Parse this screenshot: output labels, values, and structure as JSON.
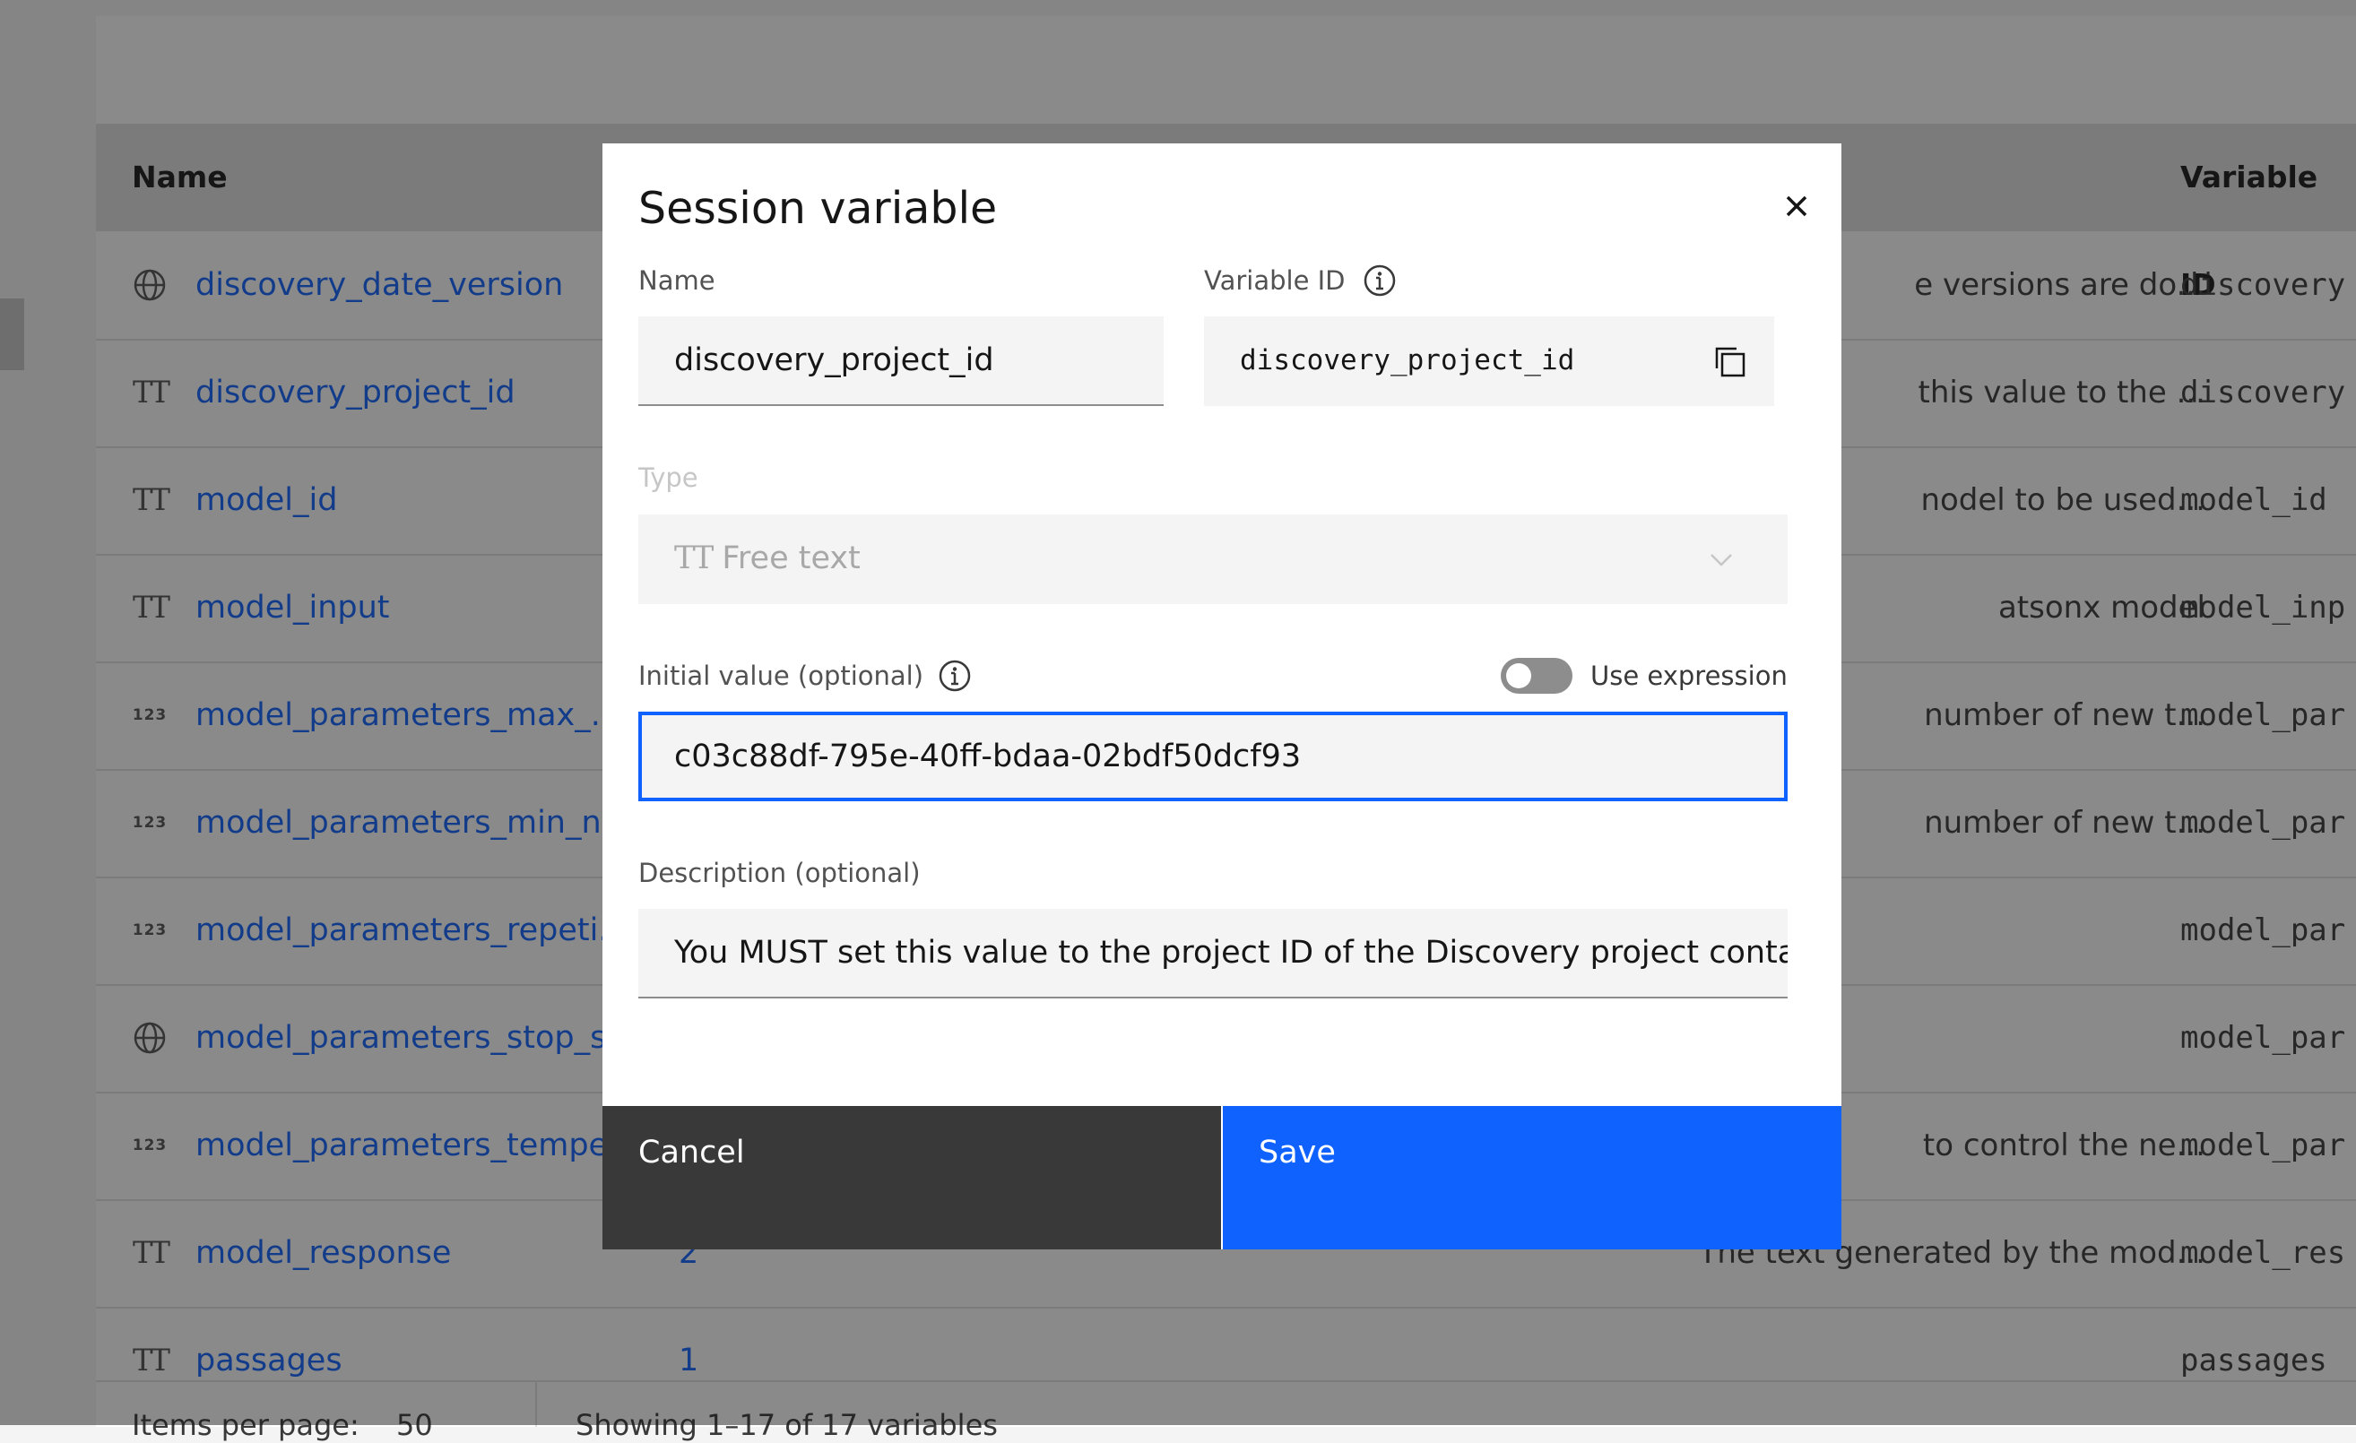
{
  "table": {
    "headers": {
      "name": "Name",
      "variable_id": "Variable ID"
    },
    "rows": [
      {
        "icon": "globe-icon",
        "name": "discovery_date_version",
        "count": "",
        "description": "e versions are do...",
        "variable_id": "discovery"
      },
      {
        "icon": "text-type-icon",
        "name": "discovery_project_id",
        "count": "",
        "description": "this value to the ...",
        "variable_id": "discovery"
      },
      {
        "icon": "text-type-icon",
        "name": "model_id",
        "count": "",
        "description": "nodel to be used...",
        "variable_id": "model_id"
      },
      {
        "icon": "text-type-icon",
        "name": "model_input",
        "count": "",
        "description": "atsonx model",
        "variable_id": "model_inp"
      },
      {
        "icon": "number-type-icon",
        "name": "model_parameters_max_...",
        "count": "",
        "description": "number of new t...",
        "variable_id": "model_par"
      },
      {
        "icon": "number-type-icon",
        "name": "model_parameters_min_n...",
        "count": "",
        "description": "number of new t...",
        "variable_id": "model_par"
      },
      {
        "icon": "number-type-icon",
        "name": "model_parameters_repeti...",
        "count": "",
        "description": "",
        "variable_id": "model_par"
      },
      {
        "icon": "globe-icon",
        "name": "model_parameters_stop_s...",
        "count": "",
        "description": "",
        "variable_id": "model_par"
      },
      {
        "icon": "number-type-icon",
        "name": "model_parameters_tempe...",
        "count": "",
        "description": "to control the ne...",
        "variable_id": "model_par"
      },
      {
        "icon": "text-type-icon",
        "name": "model_response",
        "count": "2",
        "description": "The text generated by the mod...",
        "variable_id": "model_res"
      },
      {
        "icon": "text-type-icon",
        "name": "passages",
        "count": "1",
        "description": "",
        "variable_id": "passages"
      }
    ],
    "footer": {
      "items_per_page_label": "Items per page:",
      "items_per_page_value": "50",
      "showing": "Showing 1–17 of 17 variables"
    }
  },
  "modal": {
    "title": "Session variable",
    "name_label": "Name",
    "name_value": "discovery_project_id",
    "variable_id_label": "Variable ID",
    "variable_id_value": "discovery_project_id",
    "type_label": "Type",
    "type_icon": "TT",
    "type_value": "Free text",
    "initial_value_label": "Initial value (optional)",
    "use_expression_label": "Use expression",
    "use_expression_on": false,
    "initial_value": "c03c88df-795e-40ff-bdaa-02bdf50dcf93",
    "description_label": "Description (optional)",
    "description_value": "You MUST set this value to the project ID of the Discovery project containin",
    "cancel_label": "Cancel",
    "save_label": "Save"
  },
  "colors": {
    "primary": "#0f62fe",
    "cancel": "#393939",
    "overlay": "rgba(22,22,22,0.5)"
  }
}
